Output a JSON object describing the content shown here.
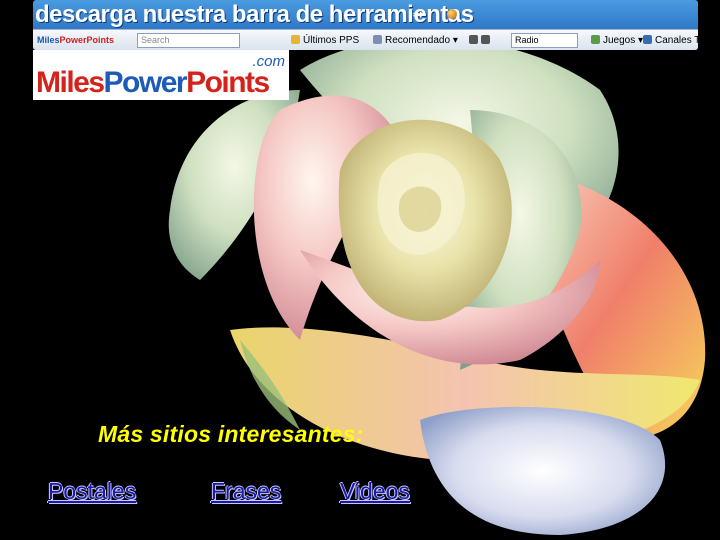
{
  "banner": {
    "title": "descarga nuestra barra de herramientas",
    "toolbar": {
      "logo_a": "Miles",
      "logo_b": "PowerPoints",
      "search_placeholder": "Search",
      "ultimos": "Últimos PPS",
      "recomendado": "Recomendado",
      "radio": "Radio",
      "juegos": "Juegos",
      "canales": "Canales TV"
    }
  },
  "logo": {
    "com": ".com",
    "part1": "Miles",
    "part2": "Power",
    "part3": "Points"
  },
  "more": {
    "title": "Más sitios interesantes:"
  },
  "links": {
    "postales": "Postales",
    "frases": "Frases",
    "videos": "Videos"
  }
}
